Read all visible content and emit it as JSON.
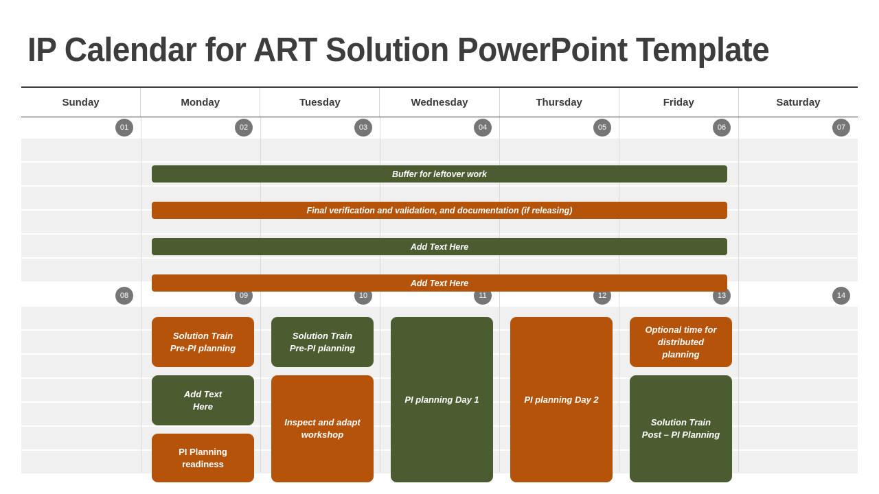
{
  "page": {
    "title": "IP Calendar for ART Solution PowerPoint Template"
  },
  "calendar": {
    "day_headers": [
      "Sunday",
      "Monday",
      "Tuesday",
      "Wednesday",
      "Thursday",
      "Friday",
      "Saturday"
    ],
    "colors": {
      "green": "#4b5c30",
      "orange": "#b45309",
      "day_circle": "#767676",
      "row_stripe": "#f0f0f0",
      "frame_border": "#3a3a3a",
      "title_text": "#3d3d3d"
    },
    "weeks": [
      {
        "dates": [
          "01",
          "02",
          "03",
          "04",
          "05",
          "06",
          "07"
        ],
        "bars": [
          {
            "label": "Buffer for leftover work",
            "color": "green"
          },
          {
            "label": "Final verification and validation, and documentation (if releasing)",
            "color": "orange"
          },
          {
            "label": "Add Text Here",
            "color": "green"
          },
          {
            "label": "Add Text Here",
            "color": "orange"
          }
        ]
      },
      {
        "dates": [
          "08",
          "09",
          "10",
          "11",
          "12",
          "13",
          "14"
        ],
        "cards": [
          {
            "label": "Solution Train\nPre-PI planning",
            "color": "orange",
            "day": "Monday",
            "italic": true
          },
          {
            "label": "Add Text\nHere",
            "color": "green",
            "day": "Monday",
            "italic": true
          },
          {
            "label": "PI Planning\nreadiness",
            "color": "orange",
            "day": "Monday",
            "italic": false
          },
          {
            "label": "Solution Train\nPre-PI planning",
            "color": "green",
            "day": "Tuesday",
            "italic": true
          },
          {
            "label": "Inspect and adapt\nworkshop",
            "color": "orange",
            "day": "Tuesday",
            "italic": true
          },
          {
            "label": "PI planning Day 1",
            "color": "green",
            "day": "Wednesday",
            "italic": true
          },
          {
            "label": "PI planning Day 2",
            "color": "orange",
            "day": "Thursday",
            "italic": true
          },
          {
            "label": "Optional time for\ndistributed\nplanning",
            "color": "orange",
            "day": "Friday",
            "italic": true
          },
          {
            "label": "Solution Train\nPost – PI Planning",
            "color": "green",
            "day": "Friday",
            "italic": true
          }
        ]
      }
    ]
  }
}
